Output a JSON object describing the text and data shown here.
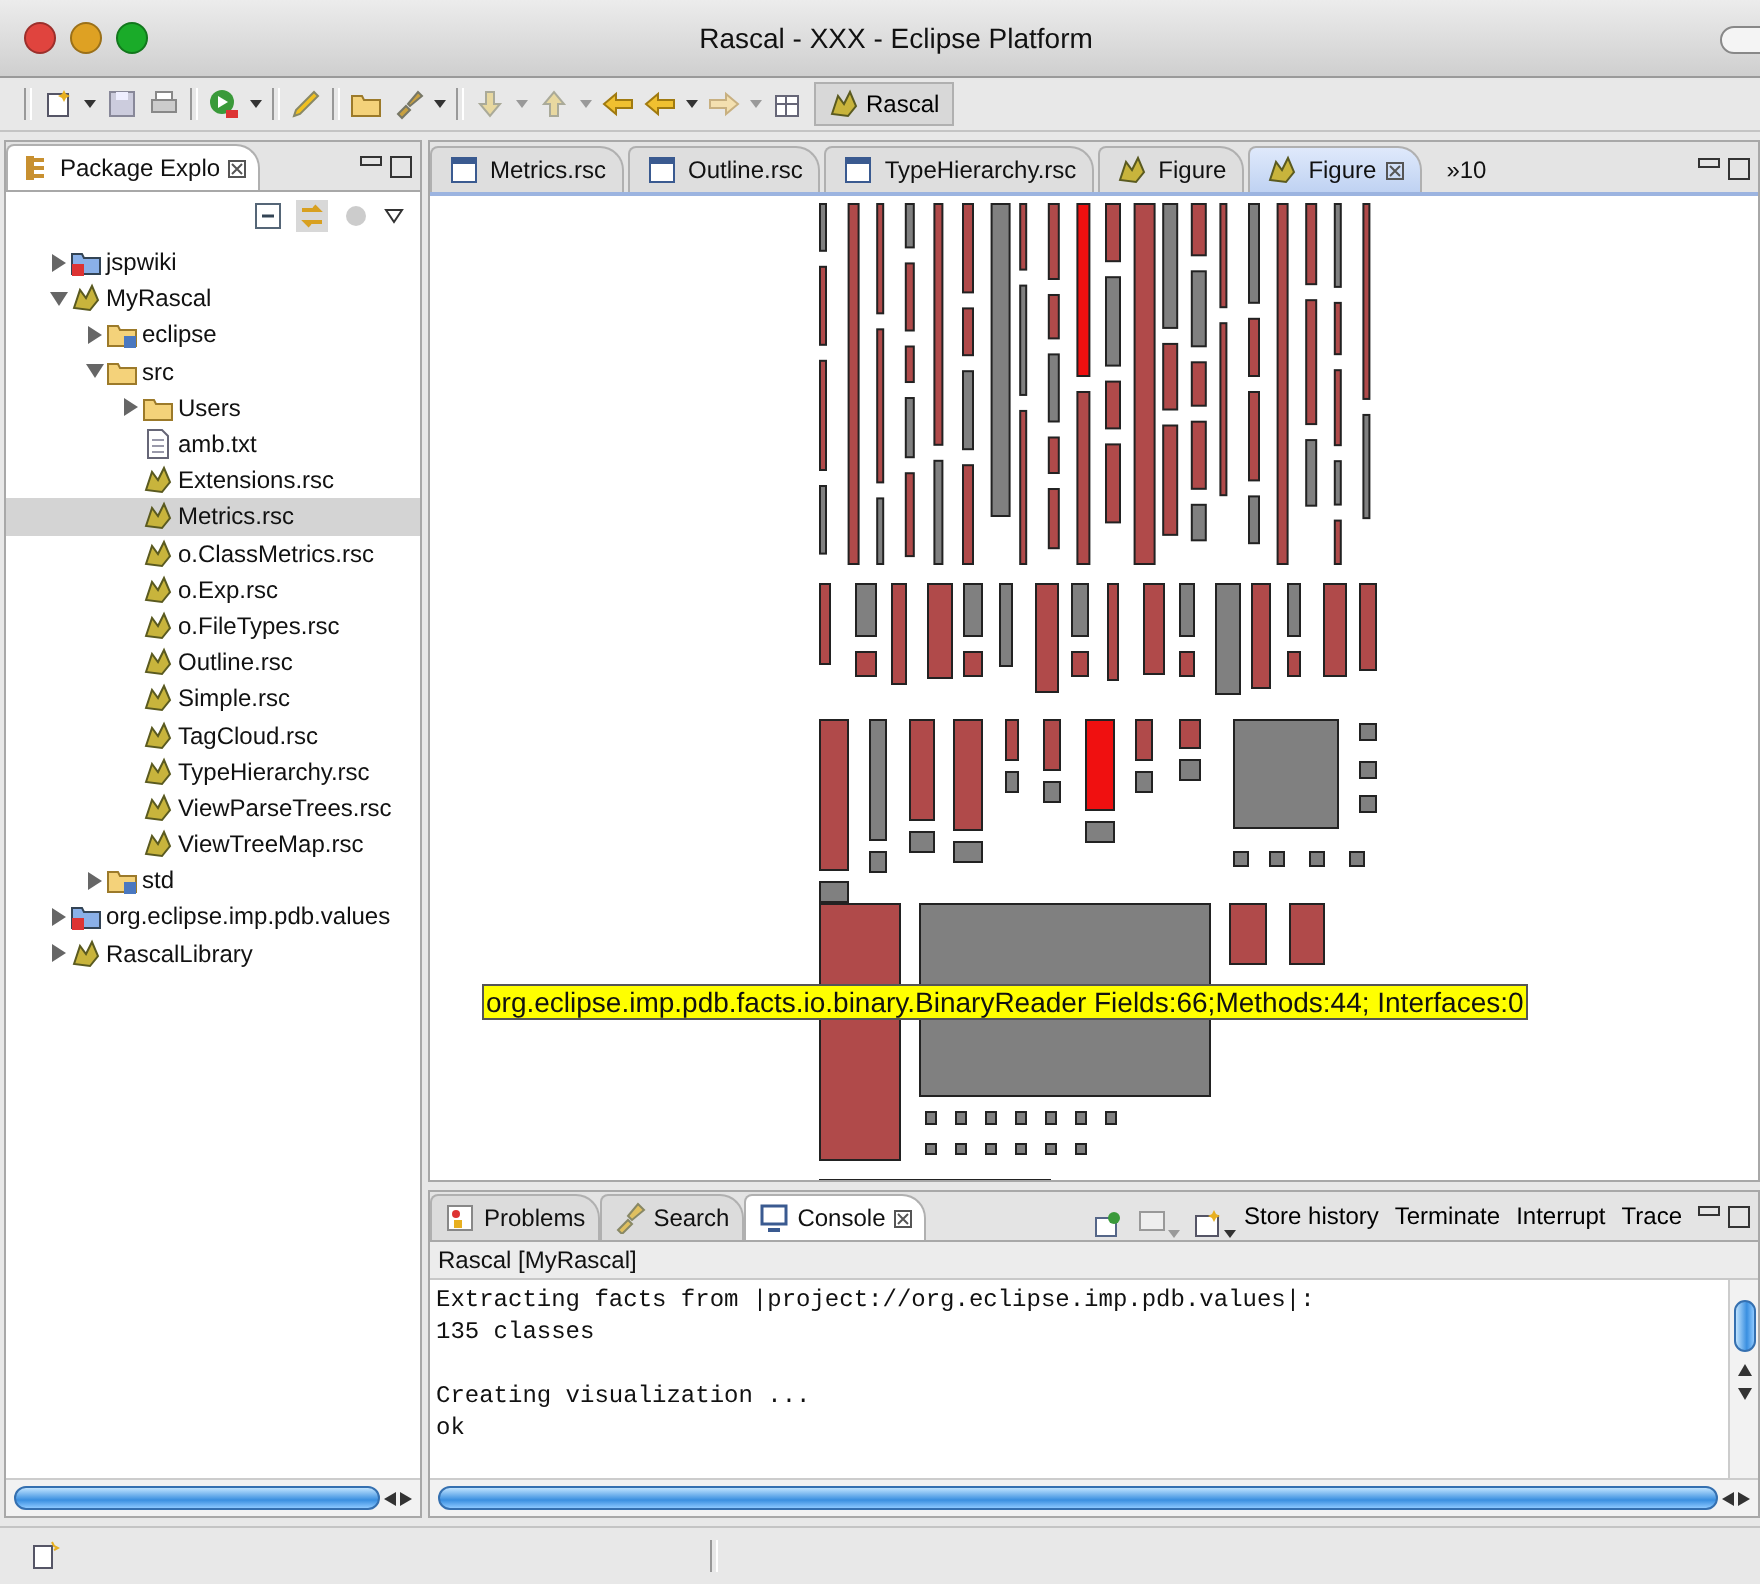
{
  "window": {
    "title": "Rascal - XXX - Eclipse Platform"
  },
  "toolbar": {
    "perspective": "Rascal"
  },
  "package_explorer": {
    "title": "Package Explo",
    "tree": [
      {
        "label": "jspwiki",
        "kind": "project",
        "expanded": false,
        "selected": false
      },
      {
        "label": "MyRascal",
        "kind": "rascal_project",
        "expanded": true,
        "selected": false,
        "children": [
          {
            "label": "eclipse",
            "kind": "package_folder",
            "expanded": false,
            "selected": false
          },
          {
            "label": "src",
            "kind": "folder",
            "expanded": true,
            "selected": false,
            "children": [
              {
                "label": "Users",
                "kind": "folder",
                "expanded": false,
                "selected": false
              },
              {
                "label": "amb.txt",
                "kind": "file",
                "selected": false
              },
              {
                "label": "Extensions.rsc",
                "kind": "module",
                "selected": false
              },
              {
                "label": "Metrics.rsc",
                "kind": "module",
                "selected": true
              },
              {
                "label": "o.ClassMetrics.rsc",
                "kind": "module",
                "selected": false
              },
              {
                "label": "o.Exp.rsc",
                "kind": "module",
                "selected": false
              },
              {
                "label": "o.FileTypes.rsc",
                "kind": "module",
                "selected": false
              },
              {
                "label": "Outline.rsc",
                "kind": "module",
                "selected": false
              },
              {
                "label": "Simple.rsc",
                "kind": "module",
                "selected": false
              },
              {
                "label": "TagCloud.rsc",
                "kind": "module",
                "selected": false
              },
              {
                "label": "TypeHierarchy.rsc",
                "kind": "module",
                "selected": false
              },
              {
                "label": "ViewParseTrees.rsc",
                "kind": "module",
                "selected": false
              },
              {
                "label": "ViewTreeMap.rsc",
                "kind": "module",
                "selected": false
              }
            ]
          },
          {
            "label": "std",
            "kind": "package_folder",
            "expanded": false,
            "selected": false
          }
        ]
      },
      {
        "label": "org.eclipse.imp.pdb.values",
        "kind": "project",
        "expanded": false,
        "selected": false
      },
      {
        "label": "RascalLibrary",
        "kind": "rascal_project",
        "expanded": false,
        "selected": false
      }
    ]
  },
  "editor_tabs": [
    {
      "label": "Metrics.rsc",
      "kind": "file",
      "selected": false
    },
    {
      "label": "Outline.rsc",
      "kind": "file",
      "selected": false
    },
    {
      "label": "TypeHierarchy.rsc",
      "kind": "file",
      "selected": false
    },
    {
      "label": "Figure",
      "kind": "figure",
      "selected": false
    },
    {
      "label": "Figure",
      "kind": "figure",
      "selected": true
    }
  ],
  "editor_overflow": "»10",
  "figure": {
    "tooltip": "org.eclipse.imp.pdb.facts.io.binary.BinaryReader Fields:66;Methods:44; Interfaces:0"
  },
  "console": {
    "tabs": [
      {
        "label": "Problems",
        "kind": "problems",
        "selected": false
      },
      {
        "label": "Search",
        "kind": "search",
        "selected": false
      },
      {
        "label": "Console",
        "kind": "console",
        "selected": true
      }
    ],
    "actions": [
      "Store history",
      "Terminate",
      "Interrupt",
      "Trace"
    ],
    "title": "Rascal [MyRascal]",
    "blocks": [
      [
        "Extracting facts from |project://org.eclipse.imp.pdb.values|:",
        "135 classes"
      ],
      [
        "Creating visualization ...",
        "ok"
      ]
    ]
  }
}
